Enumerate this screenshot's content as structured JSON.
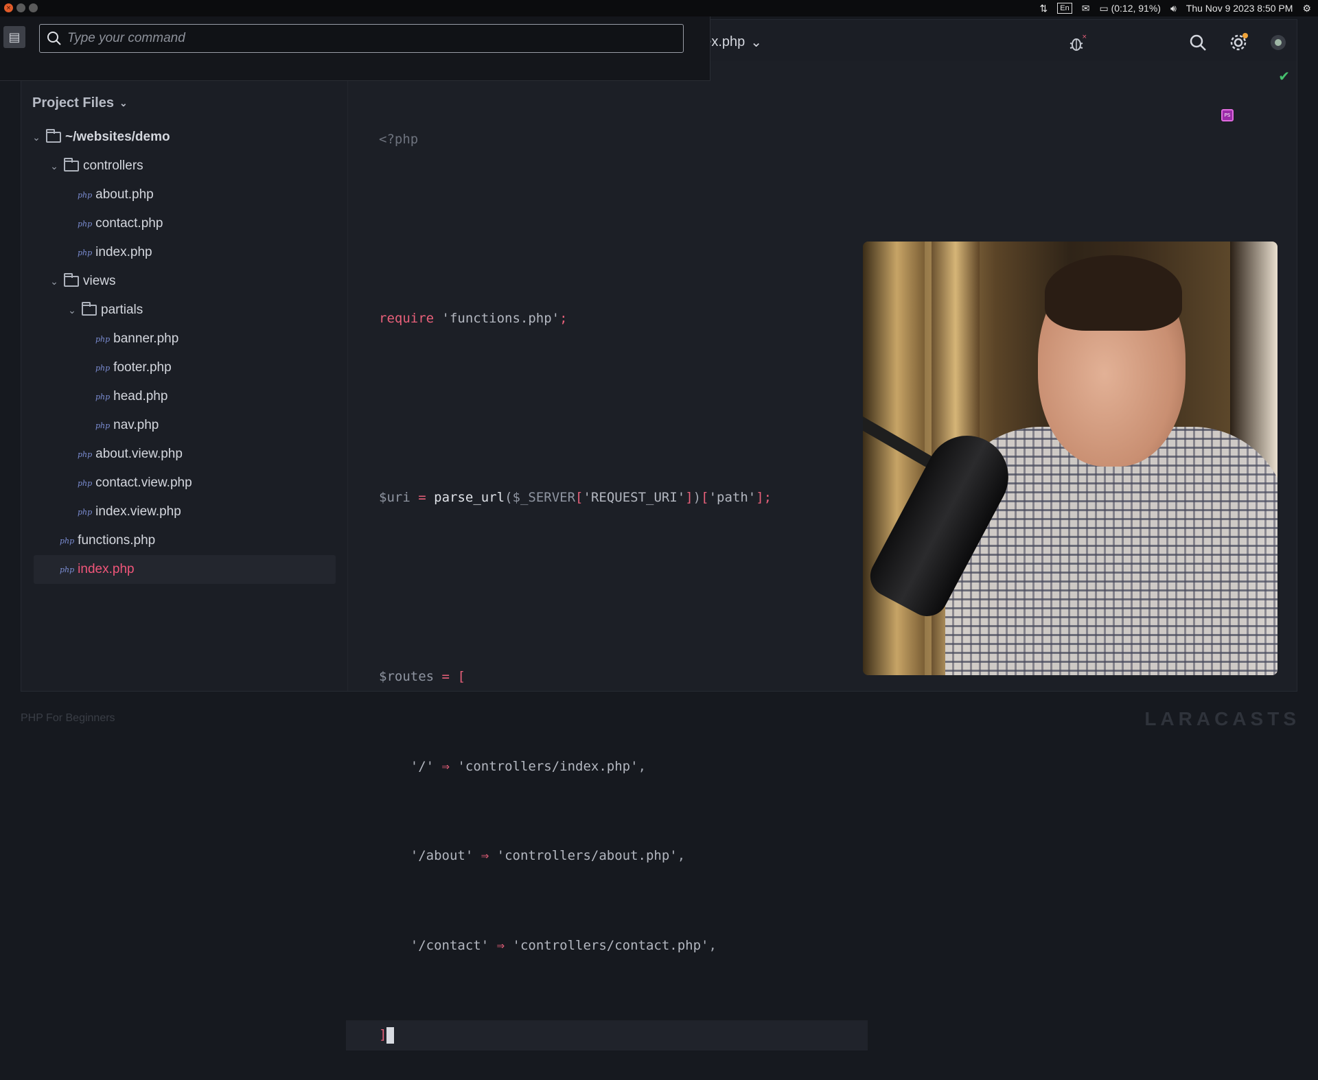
{
  "system_bar": {
    "input_lang": "En",
    "battery": "(0:12, 91%)",
    "datetime": "Thu Nov 9 2023  8:50 PM"
  },
  "palette": {
    "placeholder": "Type your command"
  },
  "header": {
    "file_tab": "ndex.php"
  },
  "sidebar": {
    "title": "Project Files",
    "tree": [
      {
        "label": "~/websites/demo",
        "type": "folder",
        "depth": 0
      },
      {
        "label": "controllers",
        "type": "folder",
        "depth": 1
      },
      {
        "label": "about.php",
        "type": "file",
        "depth": 2
      },
      {
        "label": "contact.php",
        "type": "file",
        "depth": 2
      },
      {
        "label": "index.php",
        "type": "file",
        "depth": 2
      },
      {
        "label": "views",
        "type": "folder",
        "depth": 1
      },
      {
        "label": "partials",
        "type": "folder",
        "depth": 2
      },
      {
        "label": "banner.php",
        "type": "file",
        "depth": 3
      },
      {
        "label": "footer.php",
        "type": "file",
        "depth": 3
      },
      {
        "label": "head.php",
        "type": "file",
        "depth": 3
      },
      {
        "label": "nav.php",
        "type": "file",
        "depth": 3
      },
      {
        "label": "about.view.php",
        "type": "file",
        "depth": 2
      },
      {
        "label": "contact.view.php",
        "type": "file",
        "depth": 2
      },
      {
        "label": "index.view.php",
        "type": "file",
        "depth": 2
      },
      {
        "label": "functions.php",
        "type": "file",
        "depth": 1
      },
      {
        "label": "index.php",
        "type": "file",
        "depth": 1,
        "selected": true
      }
    ]
  },
  "code": {
    "lines": [
      "<?php",
      "",
      "require 'functions.php';",
      "",
      "$uri = parse_url($_SERVER['REQUEST_URI'])['path'];",
      "",
      "$routes = [",
      "    '/' => 'controllers/index.php',",
      "    '/about' => 'controllers/about.php',",
      "    '/contact' => 'controllers/contact.php',",
      "];"
    ]
  },
  "footer": {
    "course": "PHP For Beginners",
    "brand": "LARACASTS"
  },
  "colors": {
    "accent": "#f0567a",
    "keyword": "#e8607a",
    "ok": "#45c06d"
  },
  "icons": [
    "search-icon",
    "gear-icon",
    "bug-icon",
    "folder-icon",
    "php-file-icon",
    "chevron-down-icon",
    "check-icon",
    "terminal-icon"
  ]
}
